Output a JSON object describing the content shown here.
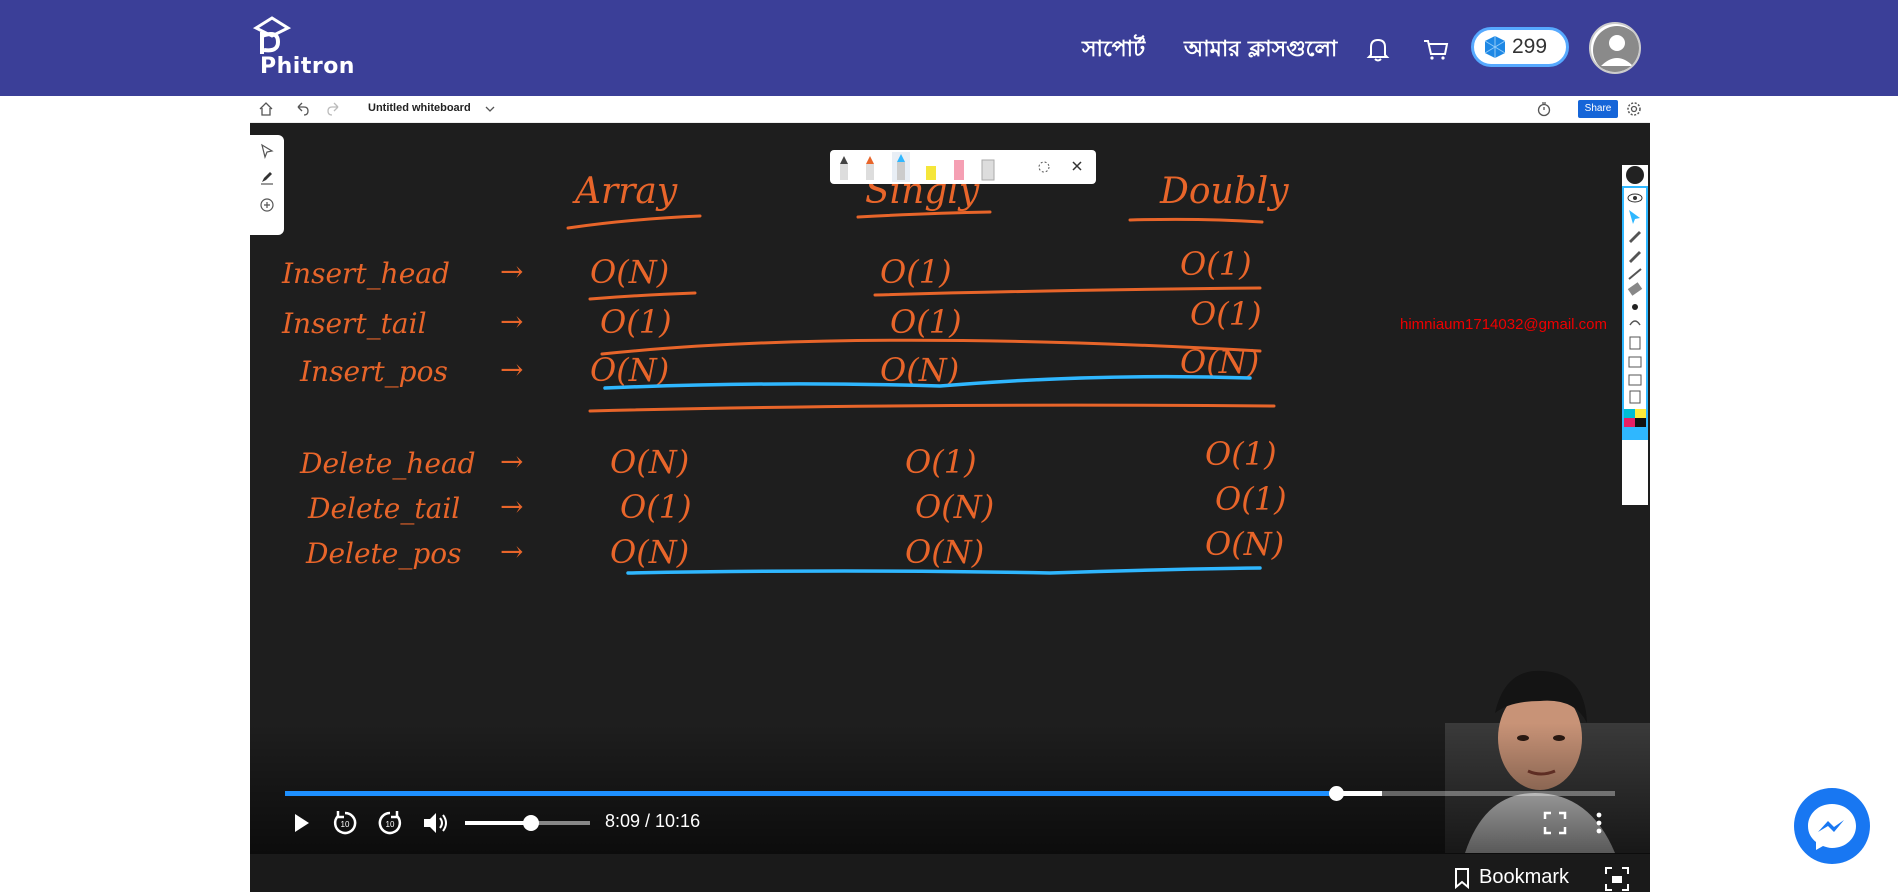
{
  "header": {
    "logo_text": "Phitron",
    "nav": [
      "সাপোর্ট",
      "আমার ক্লাসগুলো"
    ],
    "coins": "299",
    "colors": {
      "bar": "#3b3f98",
      "coin_border": "#56a9ff"
    }
  },
  "whiteboard": {
    "title": "Untitled whiteboard",
    "share_label": "Share",
    "watermark_email": "himniaum1714032@gmail.com"
  },
  "board": {
    "columns": [
      "Array",
      "Singly",
      "Doubly"
    ],
    "rows": [
      {
        "op": "Insert_head",
        "arrow": "→",
        "cells": [
          "O(N)",
          "O(1)",
          "O(1)"
        ]
      },
      {
        "op": "Insert_tail",
        "arrow": "→",
        "cells": [
          "O(1)",
          "O(1)",
          "O(1)"
        ]
      },
      {
        "op": "Insert_pos",
        "arrow": "→",
        "cells": [
          "O(N)",
          "O(N)",
          "O(N)"
        ]
      },
      {
        "op": "Delete_head",
        "arrow": "→",
        "cells": [
          "O(N)",
          "O(1)",
          "O(1)"
        ]
      },
      {
        "op": "Delete_tail",
        "arrow": "→",
        "cells": [
          "O(1)",
          "O(N)",
          "O(1)"
        ]
      },
      {
        "op": "Delete_pos",
        "arrow": "→",
        "cells": [
          "O(N)",
          "O(N)",
          "O(N)"
        ]
      }
    ],
    "ink_color": "#e8652a",
    "highlight_color": "#2fb7ff"
  },
  "player": {
    "time": "8:09 / 10:16",
    "progress": 0.79,
    "buffered": 0.825,
    "volume": 0.53
  },
  "footer": {
    "bookmark_label": "Bookmark"
  }
}
